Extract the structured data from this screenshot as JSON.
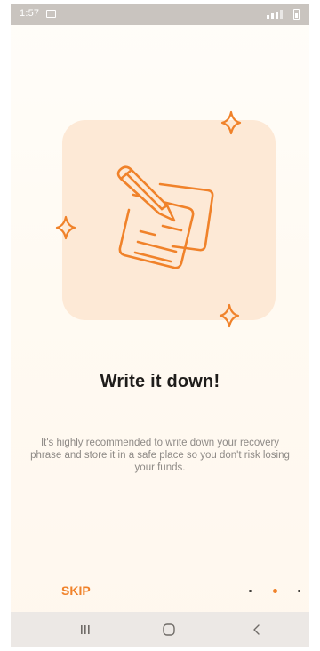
{
  "status_bar": {
    "time": "1:57"
  },
  "onboarding": {
    "title": "Write it down!",
    "description": "It's highly recommended to write down your recovery phrase and store it in a safe place so you don't risk losing your funds.",
    "skip_label": "SKIP",
    "pager": {
      "total": 3,
      "current": 2
    }
  },
  "colors": {
    "accent": "#f0822a",
    "illustration_bg": "#fde9d6",
    "title": "#1f1d1b",
    "body": "#8e8a86"
  },
  "icons": {
    "illustration": "notes-with-pencil-icon",
    "sparkles": "sparkle-icon",
    "nav_recent": "recent-apps-icon",
    "nav_home": "home-icon",
    "nav_back": "back-icon"
  }
}
